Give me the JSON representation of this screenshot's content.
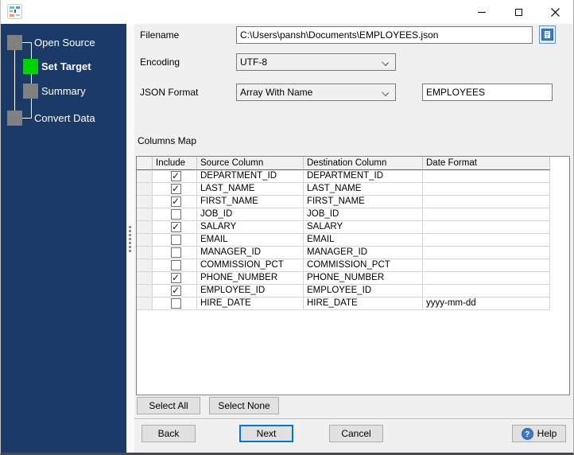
{
  "titlebar": {
    "minimize": "minimize",
    "maximize": "maximize",
    "close": "close"
  },
  "sidebar": {
    "steps": [
      {
        "label": "Open Source",
        "active": false
      },
      {
        "label": "Set Target",
        "active": true
      },
      {
        "label": "Summary",
        "active": false
      },
      {
        "label": "Convert Data",
        "active": false
      }
    ]
  },
  "form": {
    "filename_label": "Filename",
    "filename_value": "C:\\Users\\pansh\\Documents\\EMPLOYEES.json",
    "encoding_label": "Encoding",
    "encoding_value": "UTF-8",
    "json_format_label": "JSON Format",
    "json_format_value": "Array With Name",
    "json_name_value": "EMPLOYEES"
  },
  "columns_map": {
    "title": "Columns Map",
    "headers": [
      "",
      "Include",
      "Source Column",
      "Destination Column",
      "Date Format"
    ],
    "rows": [
      {
        "include": true,
        "source": "DEPARTMENT_ID",
        "destination": "DEPARTMENT_ID",
        "date_format": ""
      },
      {
        "include": true,
        "source": "LAST_NAME",
        "destination": "LAST_NAME",
        "date_format": ""
      },
      {
        "include": true,
        "source": "FIRST_NAME",
        "destination": "FIRST_NAME",
        "date_format": ""
      },
      {
        "include": false,
        "source": "JOB_ID",
        "destination": "JOB_ID",
        "date_format": ""
      },
      {
        "include": true,
        "source": "SALARY",
        "destination": "SALARY",
        "date_format": ""
      },
      {
        "include": false,
        "source": "EMAIL",
        "destination": "EMAIL",
        "date_format": ""
      },
      {
        "include": false,
        "source": "MANAGER_ID",
        "destination": "MANAGER_ID",
        "date_format": ""
      },
      {
        "include": false,
        "source": "COMMISSION_PCT",
        "destination": "COMMISSION_PCT",
        "date_format": ""
      },
      {
        "include": true,
        "source": "PHONE_NUMBER",
        "destination": "PHONE_NUMBER",
        "date_format": ""
      },
      {
        "include": true,
        "source": "EMPLOYEE_ID",
        "destination": "EMPLOYEE_ID",
        "date_format": ""
      },
      {
        "include": false,
        "source": "HIRE_DATE",
        "destination": "HIRE_DATE",
        "date_format": "yyyy-mm-dd"
      }
    ]
  },
  "buttons": {
    "select_all": "Select All",
    "select_none": "Select None",
    "back": "Back",
    "next": "Next",
    "cancel": "Cancel",
    "help": "Help"
  },
  "colors": {
    "sidebar_bg": "#1B3A68",
    "active_step_green": "#00D300",
    "inactive_step_gray": "#808080",
    "focus_border_blue": "#0078D7",
    "help_icon_blue": "#3C78C8"
  }
}
